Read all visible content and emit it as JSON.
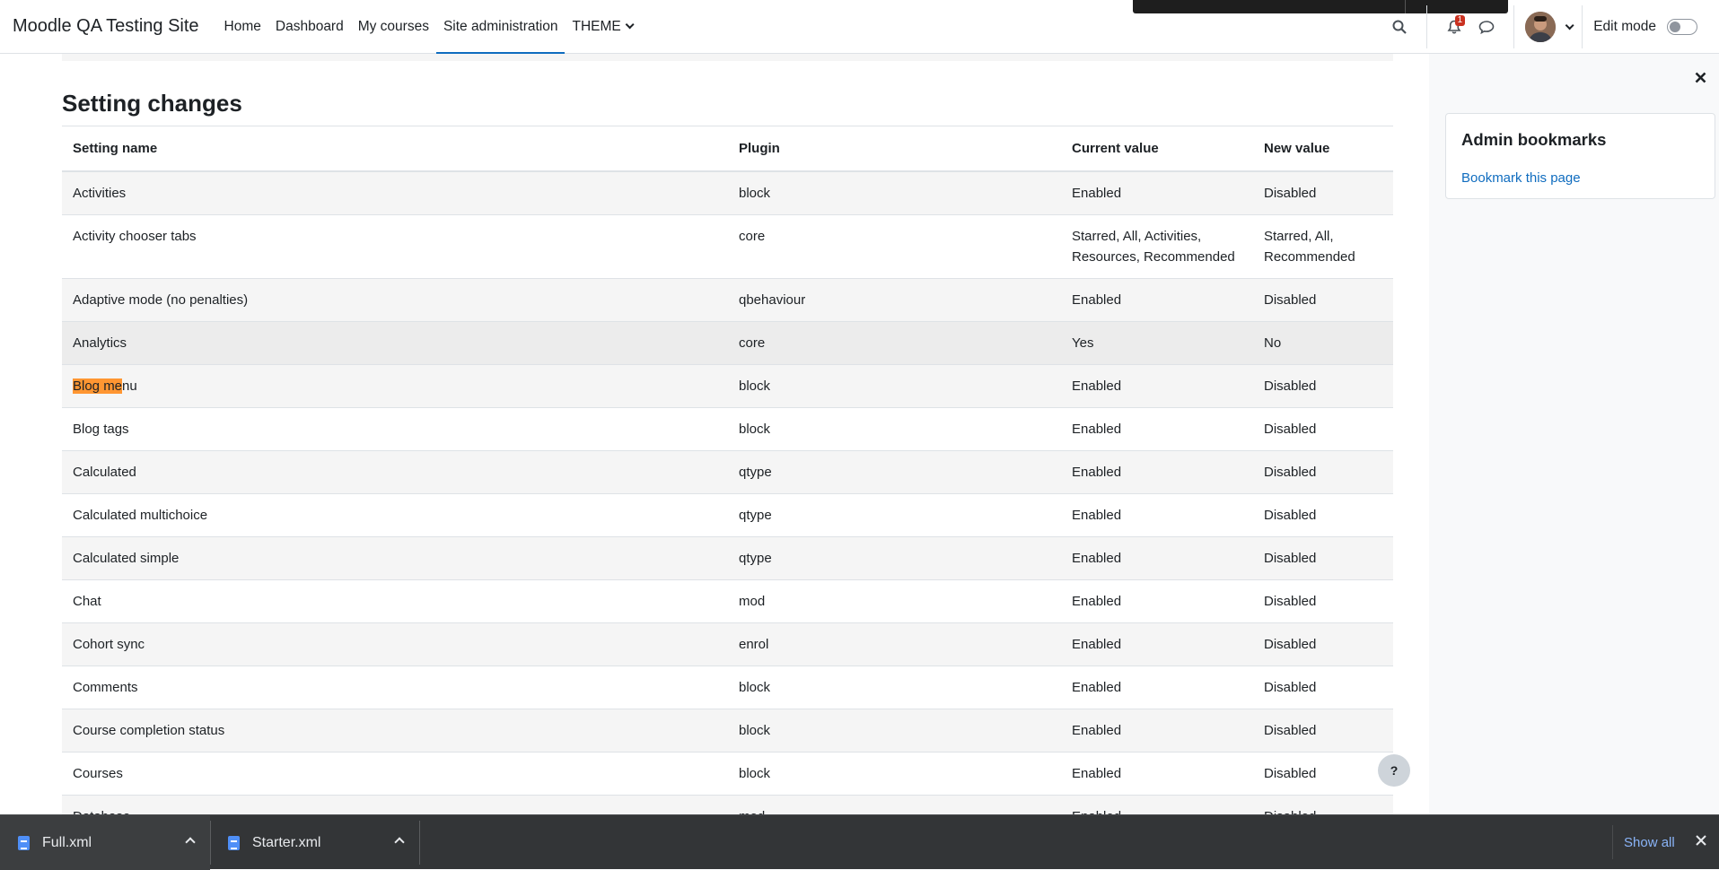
{
  "navbar": {
    "brand": "Moodle QA Testing Site",
    "items": [
      {
        "label": "Home"
      },
      {
        "label": "Dashboard"
      },
      {
        "label": "My courses"
      },
      {
        "label": "Site administration",
        "active": true
      },
      {
        "label": "THEME"
      }
    ],
    "notification_count": "1",
    "edit_mode_label": "Edit mode",
    "edit_mode_on": false
  },
  "main": {
    "title": "Setting changes",
    "table": {
      "headers": [
        "Setting name",
        "Plugin",
        "Current value",
        "New value"
      ],
      "rows": [
        {
          "name": "Activities",
          "plugin": "block",
          "current": "Enabled",
          "new": "Disabled"
        },
        {
          "name": "Activity chooser tabs",
          "plugin": "core",
          "current": "Starred, All, Activities, Resources, Recommended",
          "new": "Starred, All, Recommended"
        },
        {
          "name": "Adaptive mode (no penalties)",
          "plugin": "qbehaviour",
          "current": "Enabled",
          "new": "Disabled"
        },
        {
          "name": "Analytics",
          "plugin": "core",
          "current": "Yes",
          "new": "No"
        },
        {
          "name_highlight": "Blog me",
          "name_rest": "nu",
          "plugin": "block",
          "current": "Enabled",
          "new": "Disabled"
        },
        {
          "name": "Blog tags",
          "plugin": "block",
          "current": "Enabled",
          "new": "Disabled"
        },
        {
          "name": "Calculated",
          "plugin": "qtype",
          "current": "Enabled",
          "new": "Disabled"
        },
        {
          "name": "Calculated multichoice",
          "plugin": "qtype",
          "current": "Enabled",
          "new": "Disabled"
        },
        {
          "name": "Calculated simple",
          "plugin": "qtype",
          "current": "Enabled",
          "new": "Disabled"
        },
        {
          "name": "Chat",
          "plugin": "mod",
          "current": "Enabled",
          "new": "Disabled"
        },
        {
          "name": "Cohort sync",
          "plugin": "enrol",
          "current": "Enabled",
          "new": "Disabled"
        },
        {
          "name": "Comments",
          "plugin": "block",
          "current": "Enabled",
          "new": "Disabled"
        },
        {
          "name": "Course completion status",
          "plugin": "block",
          "current": "Enabled",
          "new": "Disabled"
        },
        {
          "name": "Courses",
          "plugin": "block",
          "current": "Enabled",
          "new": "Disabled"
        },
        {
          "name": "Database",
          "plugin": "mod",
          "current": "Enabled",
          "new": "Disabled"
        }
      ]
    }
  },
  "drawer": {
    "card_title": "Admin bookmarks",
    "card_link": "Bookmark this page"
  },
  "help_label": "?",
  "downloads": {
    "items": [
      {
        "name": "Full.xml"
      },
      {
        "name": "Starter.xml"
      }
    ],
    "show_all": "Show all"
  }
}
